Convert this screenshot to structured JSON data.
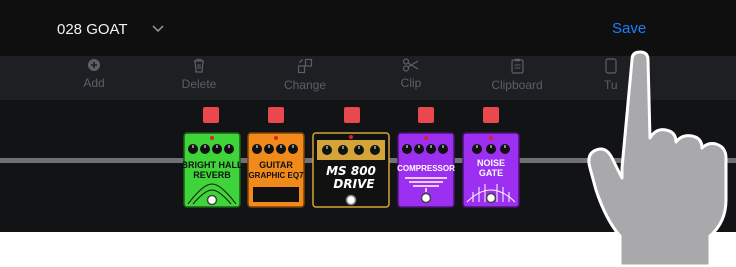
{
  "header": {
    "preset_name": "028 GOAT",
    "save_label": "Save"
  },
  "toolbar": {
    "add": "Add",
    "delete": "Delete",
    "change": "Change",
    "clip": "Clip",
    "clipboard": "Clipboard",
    "tuner": "Tu"
  },
  "chain": {
    "pedals": [
      {
        "name_line1": "BRIGHT HALL",
        "name_line2": "REVERB",
        "color": "#3ed43a",
        "icon": "reverb-icon"
      },
      {
        "name_line1": "GUITAR",
        "name_line2": "GRAPHIC EQ7",
        "color": "#f08a1a",
        "icon": "eq-icon"
      },
      {
        "name_line1": "MS 800",
        "name_line2": "DRIVE",
        "color": "#111111",
        "icon": "drive-icon"
      },
      {
        "name_line1": "COMPRESSOR",
        "name_line2": "",
        "color": "#9c2ff0",
        "icon": "compressor-icon"
      },
      {
        "name_line1": "NOISE",
        "name_line2": "GATE",
        "color": "#9c2ff0",
        "icon": "gate-icon"
      }
    ]
  },
  "colors": {
    "accent": "#1e7dff",
    "toggle_on": "#e8484e"
  }
}
